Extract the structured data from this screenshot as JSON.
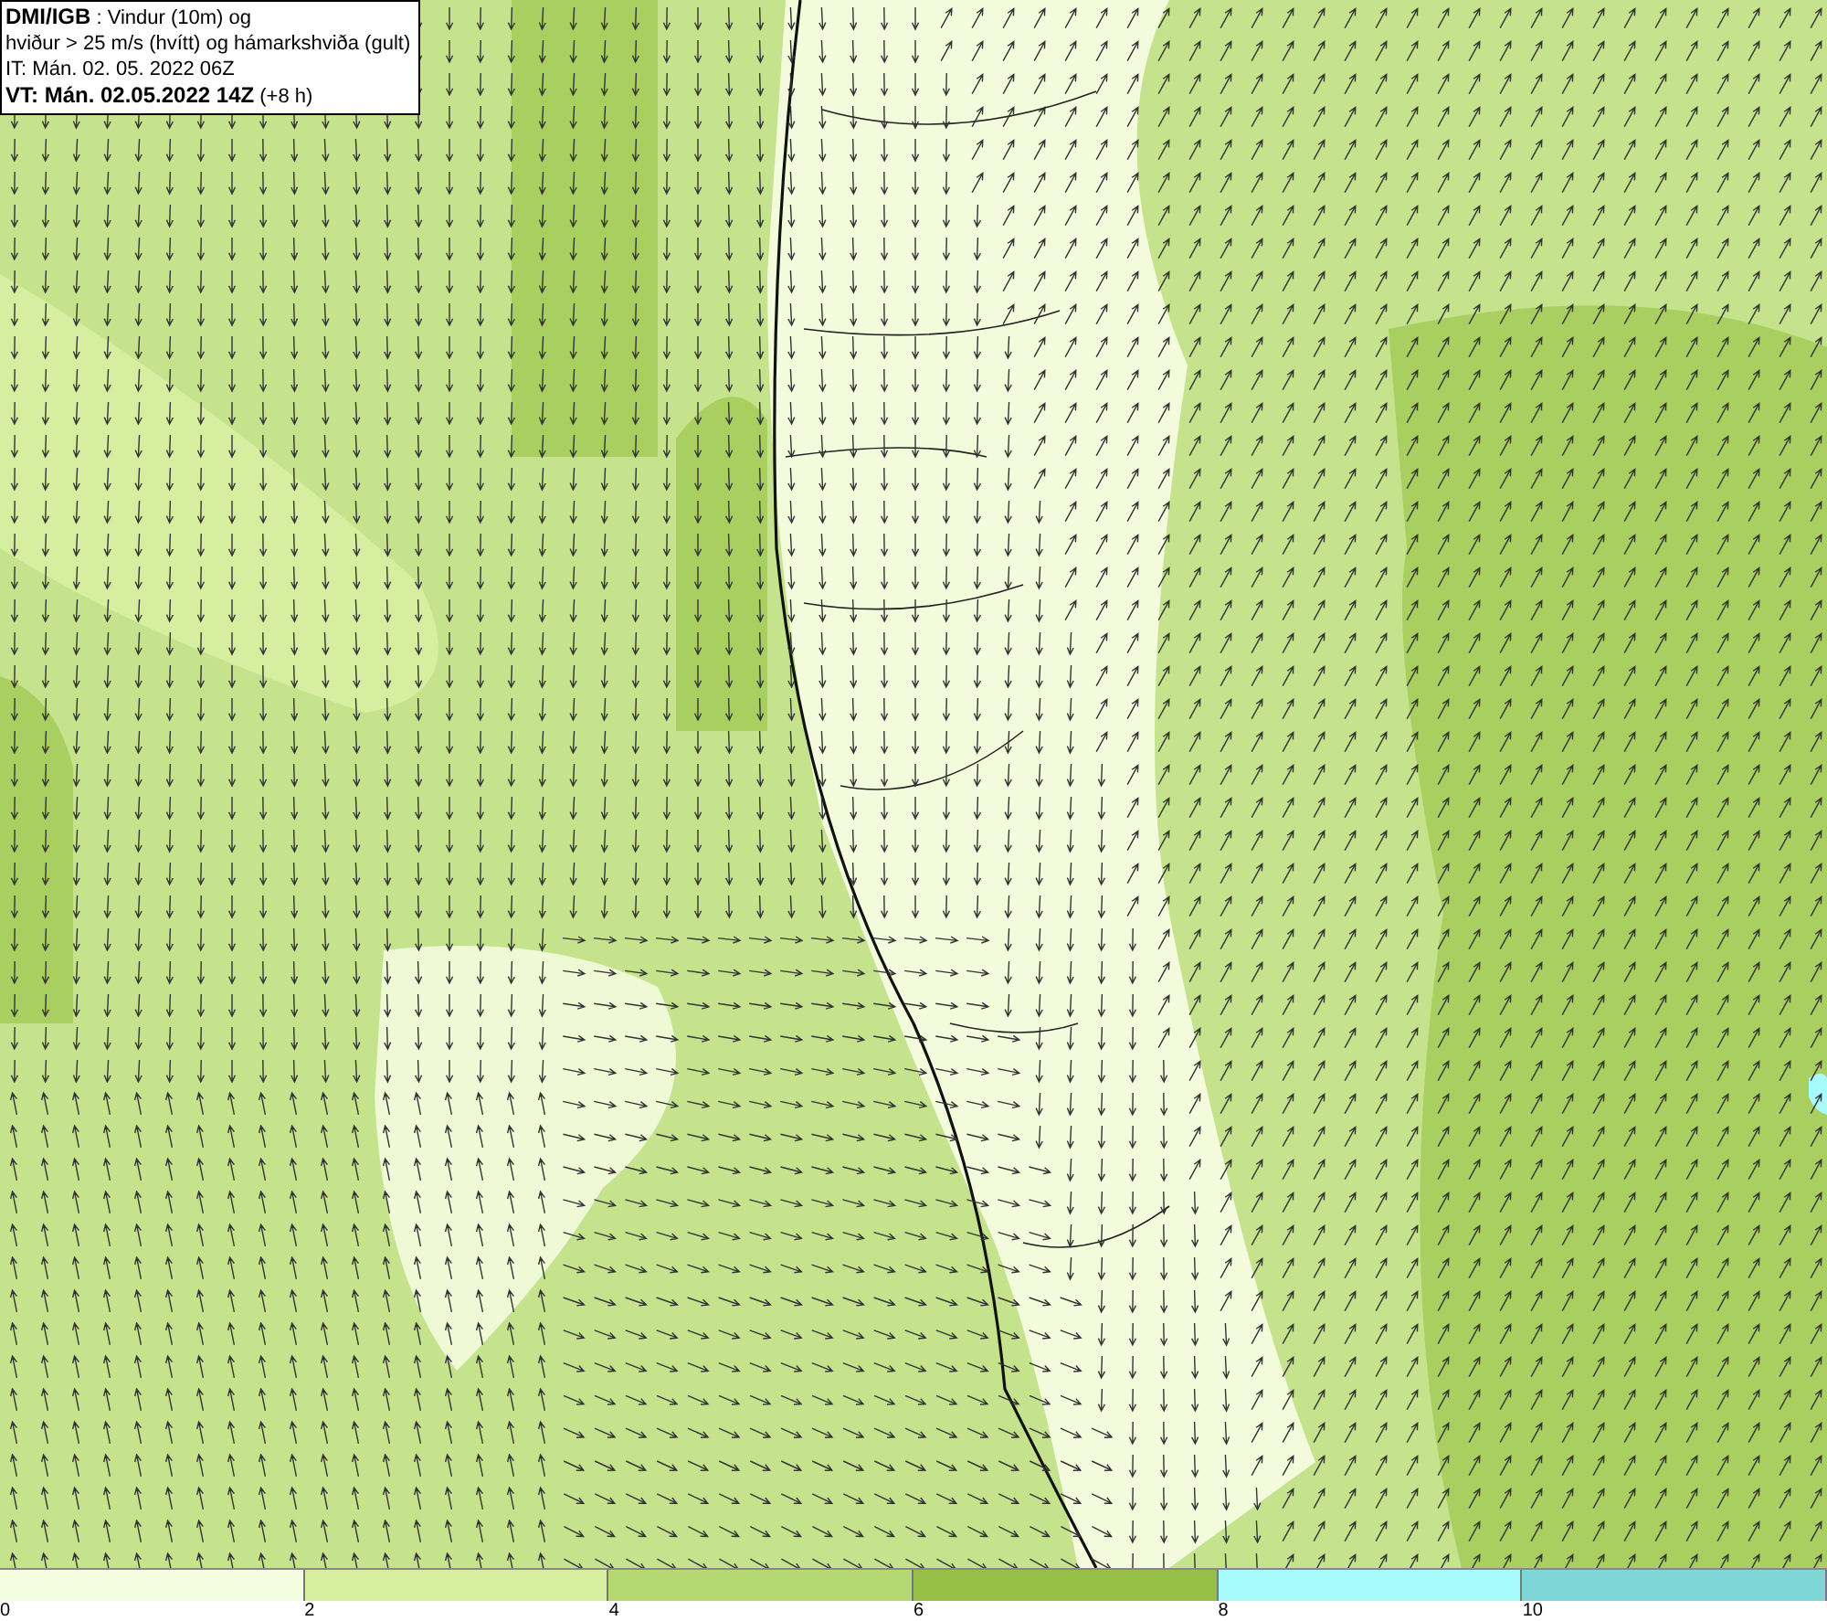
{
  "map_title": {
    "lines": [
      "**DMI/IGB** : Vindur (10m) og",
      "hviður > 25 m/s (hvítt) og hámarkshviða (gult)",
      "IT: Mán. 02. 05. 2022 06Z",
      "**VT: Mán. 02.05.2022 14Z** (+8 h)"
    ]
  },
  "legend": {
    "segments": [
      {
        "color": "#f5fde0"
      },
      {
        "color": "#d6eea0"
      },
      {
        "color": "#b5d873"
      },
      {
        "color": "#96bf48"
      },
      {
        "color": "#a8fbfb"
      },
      {
        "color": "#7ed6d6"
      }
    ],
    "ticks": [
      "0",
      "2",
      "4",
      "6",
      "8",
      "10"
    ]
  }
}
